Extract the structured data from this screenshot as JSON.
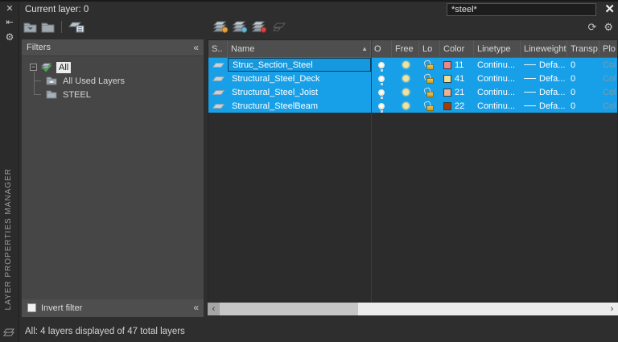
{
  "panel": {
    "vertical_title": "LAYER PROPERTIES MANAGER",
    "current_layer": "Current layer: 0",
    "status_text": "All: 4 layers displayed of 47 total layers"
  },
  "search": {
    "value": "*steel*"
  },
  "icons": {
    "close": "✕",
    "autohide": "⇤",
    "properties": "⚙",
    "refresh": "⟳",
    "settings": "⚙",
    "collapse": "«",
    "sort_asc": "▲",
    "tree_expand": "−",
    "scroll_left": "‹",
    "scroll_right": "›"
  },
  "filters": {
    "title": "Filters",
    "invert_label": "Invert filter",
    "tree": [
      {
        "label": "All",
        "selected": true
      },
      {
        "label": "All Used Layers",
        "selected": false
      },
      {
        "label": "STEEL",
        "selected": false
      }
    ]
  },
  "table": {
    "columns": [
      "S..",
      "Name",
      "O",
      "Free",
      "Lo",
      "Color",
      "Linetype",
      "Lineweight",
      "Transp...",
      "Plo"
    ],
    "rows": [
      {
        "name": "Struc_Section_Steel",
        "editing": true,
        "color_index": "11",
        "color_hex": "#f28585",
        "linetype": "Continu...",
        "lineweight": "Defa...",
        "transparency": "0",
        "plot_style": "Col"
      },
      {
        "name": "Structural_Steel_Deck",
        "editing": false,
        "color_index": "41",
        "color_hex": "#f2dd90",
        "linetype": "Continu...",
        "lineweight": "Defa...",
        "transparency": "0",
        "plot_style": "Col"
      },
      {
        "name": "Structural_Steel_Joist",
        "editing": false,
        "color_index": "21",
        "color_hex": "#f2b091",
        "linetype": "Continu...",
        "lineweight": "Defa...",
        "transparency": "0",
        "plot_style": "Col"
      },
      {
        "name": "Structural_SteelBeam",
        "editing": false,
        "color_index": "22",
        "color_hex": "#a93804",
        "linetype": "Continu...",
        "lineweight": "Defa...",
        "transparency": "0",
        "plot_style": "Col"
      }
    ]
  },
  "colors": {
    "selection": "#17a0e8",
    "panel_bg": "#2e2e2e",
    "header_bg": "#4e4e4e"
  }
}
